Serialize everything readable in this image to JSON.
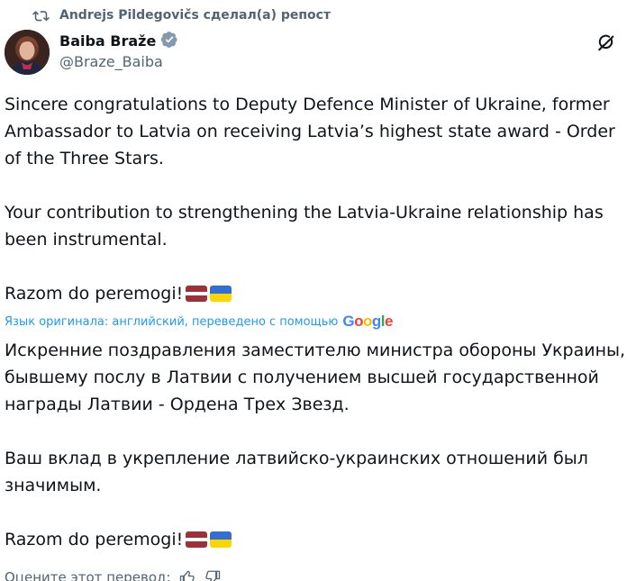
{
  "repost": {
    "icon": "repost-icon",
    "text": "Andrejs Pildegovičs сделал(а) репост"
  },
  "author": {
    "display_name": "Baiba Braže",
    "verified_icon": "verified-badge-icon",
    "handle": "@Braze_Baiba",
    "avatar": "avatar-photo"
  },
  "toolbar": {
    "grok_icon": "grok-icon"
  },
  "original": {
    "lines": [
      "Sincere congratulations to Deputy Defence Minister of Ukraine, former",
      "Ambassador to Latvia on receiving Latvia’s highest state award - Order",
      "of the Three Stars.",
      "",
      "Your contribution to strengthening the Latvia-Ukraine relationship has",
      "been instrumental.",
      ""
    ],
    "closing": "Razom do peremogi!"
  },
  "translation": {
    "note": "Язык оригинала: английский, переведено с помощью",
    "brand": "Google",
    "lines": [
      "Искренние поздравления заместителю министра обороны Украины,",
      "бывшему послу в Латвии с получением высшей государственной",
      "награды Латвии - Ордена Трех Звезд.",
      "",
      "Ваш вклад в укрепление латвийско-украинских отношений был",
      "значимым.",
      ""
    ],
    "closing": "Razom do peremogi!"
  },
  "rating": {
    "label": "Оцените этот перевод:",
    "thumbs_up_icon": "thumbs-up-icon",
    "thumbs_down_icon": "thumbs-down-icon"
  },
  "colors": {
    "text": "#0f1419",
    "secondary": "#536471",
    "link": "#1d9bf0",
    "verified": "#829aab",
    "latvia_red": "#9e3039",
    "ukraine_blue": "#2f6fd6",
    "ukraine_yellow": "#ffd500"
  }
}
